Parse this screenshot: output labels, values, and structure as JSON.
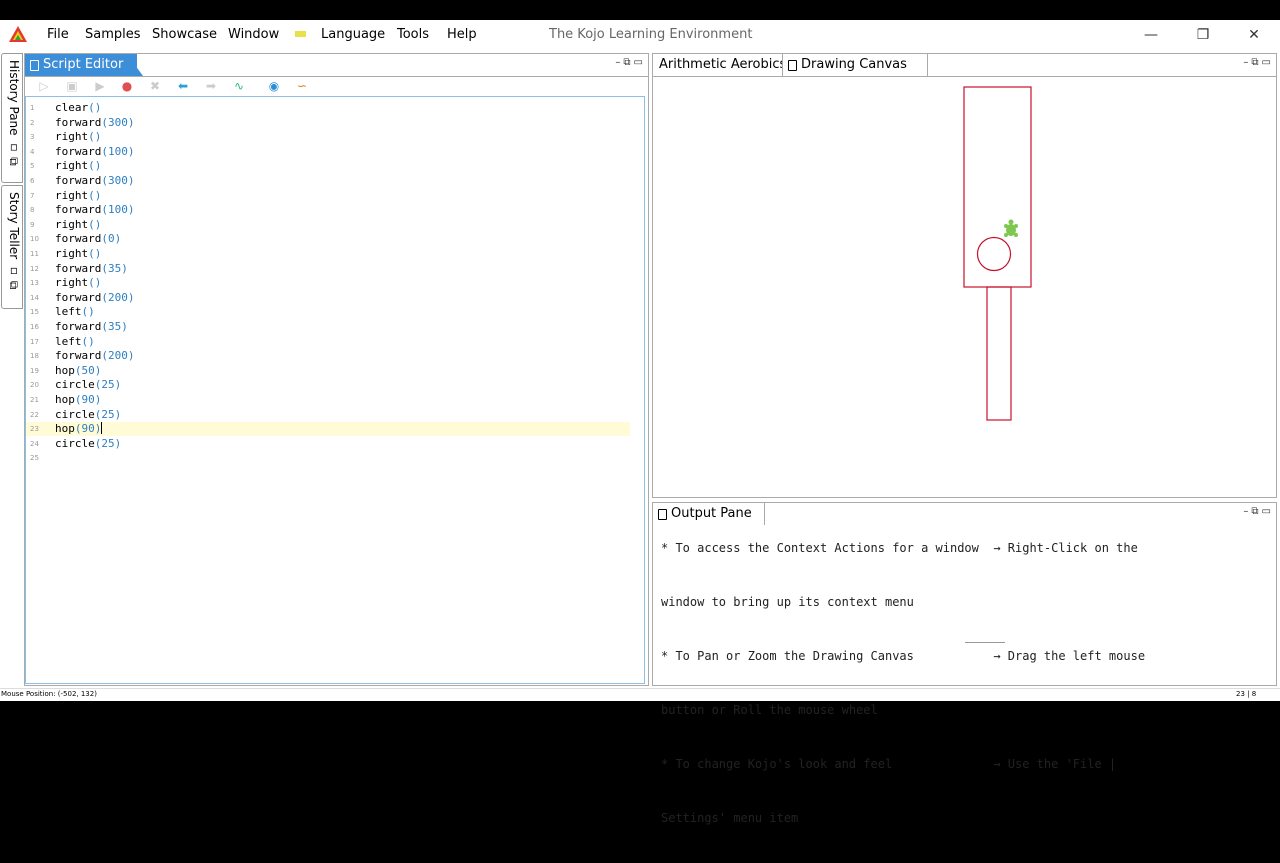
{
  "menubar": {
    "items": [
      "File",
      "Samples",
      "Showcase",
      "Window",
      "Language",
      "Tools",
      "Help"
    ],
    "title": "The Kojo Learning Environment",
    "window_controls": [
      "minimize-icon",
      "restore-icon",
      "close-icon"
    ]
  },
  "side_tabs": {
    "history": "History Pane",
    "story": "Story Teller"
  },
  "script_editor": {
    "tab_label": "Script Editor",
    "toolbar_icons": [
      "run-icon",
      "run-worksheet-icon",
      "step-icon",
      "stop-icon",
      "clear-icon",
      "undo-icon",
      "redo-icon",
      "format-icon",
      "globe-icon",
      "kojo-icon"
    ],
    "lines": [
      {
        "n": "1",
        "fn": "clear",
        "args": "()"
      },
      {
        "n": "2",
        "fn": "forward",
        "args": "(300)"
      },
      {
        "n": "3",
        "fn": "right",
        "args": "()"
      },
      {
        "n": "4",
        "fn": "forward",
        "args": "(100)"
      },
      {
        "n": "5",
        "fn": "right",
        "args": "()"
      },
      {
        "n": "6",
        "fn": "forward",
        "args": "(300)"
      },
      {
        "n": "7",
        "fn": "right",
        "args": "()"
      },
      {
        "n": "8",
        "fn": "forward",
        "args": "(100)"
      },
      {
        "n": "9",
        "fn": "right",
        "args": "()"
      },
      {
        "n": "10",
        "fn": "forward",
        "args": "(0)"
      },
      {
        "n": "11",
        "fn": "right",
        "args": "()"
      },
      {
        "n": "12",
        "fn": "forward",
        "args": "(35)"
      },
      {
        "n": "13",
        "fn": "right",
        "args": "()"
      },
      {
        "n": "14",
        "fn": "forward",
        "args": "(200)"
      },
      {
        "n": "15",
        "fn": "left",
        "args": "()"
      },
      {
        "n": "16",
        "fn": "forward",
        "args": "(35)"
      },
      {
        "n": "17",
        "fn": "left",
        "args": "()"
      },
      {
        "n": "18",
        "fn": "forward",
        "args": "(200)"
      },
      {
        "n": "19",
        "fn": "hop",
        "args": "(50)"
      },
      {
        "n": "20",
        "fn": "circle",
        "args": "(25)"
      },
      {
        "n": "21",
        "fn": "hop",
        "args": "(90)"
      },
      {
        "n": "22",
        "fn": "circle",
        "args": "(25)"
      },
      {
        "n": "23",
        "fn": "hop",
        "args": "(90)"
      },
      {
        "n": "24",
        "fn": "circle",
        "args": "(25)"
      },
      {
        "n": "25",
        "fn": "",
        "args": ""
      }
    ]
  },
  "canvas_pane": {
    "tabs": [
      "Arithmetic Aerobics",
      "Drawing Canvas"
    ],
    "stroke_color": "#c8102e",
    "turtle_color": "#7ec850"
  },
  "output_pane": {
    "tab_label": "Output Pane",
    "lines": [
      "* To access the Context Actions for a window  → Right-Click on the",
      "window to bring up its context menu",
      "* To Pan or Zoom the Drawing Canvas           → Drag the left mouse",
      "button or Roll the mouse wheel",
      "* To change Kojo's look and feel              → Use the 'File |",
      "Settings' menu item"
    ]
  },
  "status": {
    "mouse_position": "Mouse Position: (-502, 132)",
    "cursor": "23 | 8"
  }
}
